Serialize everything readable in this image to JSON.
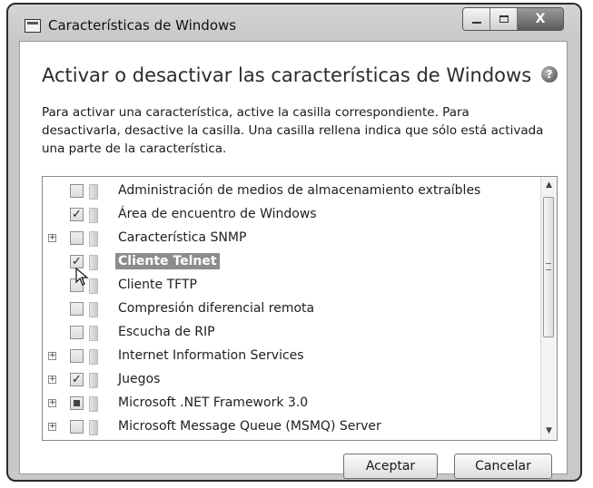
{
  "window": {
    "title": "Características de Windows",
    "controls": [
      "minimize-icon",
      "maximize-icon",
      "close-icon"
    ],
    "close_glyph": "X"
  },
  "heading": "Activar o desactivar las características de Windows",
  "help_glyph": "?",
  "description": "Para activar una característica, active la casilla correspondiente. Para desactivarla, desactive la casilla. Una casilla rellena indica que sólo está activada una parte de la característica.",
  "features": [
    {
      "label": "Administración de medios de almacenamiento extraíbles",
      "state": "unchecked",
      "expandable": false,
      "selected": false
    },
    {
      "label": "Área de encuentro de Windows",
      "state": "checked",
      "expandable": false,
      "selected": false
    },
    {
      "label": "Característica SNMP",
      "state": "unchecked",
      "expandable": true,
      "selected": false
    },
    {
      "label": "Cliente Telnet",
      "state": "checked",
      "expandable": false,
      "selected": true
    },
    {
      "label": "Cliente TFTP",
      "state": "unchecked",
      "expandable": false,
      "selected": false
    },
    {
      "label": "Compresión diferencial remota",
      "state": "unchecked",
      "expandable": false,
      "selected": false
    },
    {
      "label": "Escucha de RIP",
      "state": "unchecked",
      "expandable": false,
      "selected": false
    },
    {
      "label": "Internet Information Services",
      "state": "unchecked",
      "expandable": true,
      "selected": false
    },
    {
      "label": "Juegos",
      "state": "checked",
      "expandable": true,
      "selected": false
    },
    {
      "label": "Microsoft .NET Framework 3.0",
      "state": "partial",
      "expandable": true,
      "selected": false
    },
    {
      "label": "Microsoft Message Queue (MSMQ) Server",
      "state": "unchecked",
      "expandable": true,
      "selected": false
    }
  ],
  "glyphs": {
    "check": "✓",
    "expand": "+",
    "scroll_up": "▲",
    "scroll_down": "▼"
  },
  "buttons": {
    "ok": "Aceptar",
    "cancel": "Cancelar"
  }
}
